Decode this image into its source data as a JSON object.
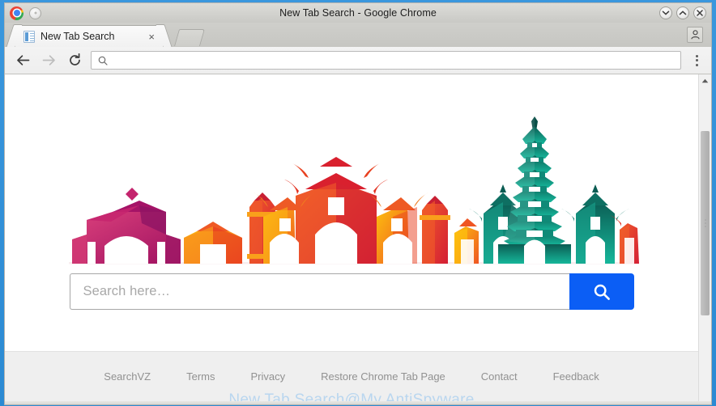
{
  "window": {
    "title": "New Tab Search - Google Chrome",
    "chrome_logo_icon": "chrome-logo-icon",
    "system_menu_icon": "window-menu-icon",
    "controls": [
      {
        "name": "minimize",
        "icon": "chevron-down-icon"
      },
      {
        "name": "maximize",
        "icon": "chevron-up-icon"
      },
      {
        "name": "close",
        "icon": "close-x-icon"
      }
    ]
  },
  "tabstrip": {
    "tab": {
      "title": "New Tab Search",
      "favicon_icon": "page-favicon-icon",
      "close_label": "×"
    },
    "new_tab_icon": "new-tab-icon",
    "profile_icon": "user-profile-icon"
  },
  "toolbar": {
    "back_icon": "arrow-left-icon",
    "forward_icon": "arrow-right-icon",
    "reload_icon": "reload-icon",
    "omnibox": {
      "icon": "search-icon",
      "value": "",
      "placeholder": ""
    },
    "menu_icon": "three-dots-menu-icon"
  },
  "page": {
    "hero": {
      "alt": "colorful low-poly vietnamese landmark skyline illustration",
      "colors": {
        "magenta": "#c21b6a",
        "pink": "#e03a6d",
        "red": "#e03127",
        "orange": "#f26522",
        "amber": "#f9a01b",
        "yellow": "#fdc20e",
        "teal": "#00a08a",
        "green_dark": "#0d6b5e",
        "purple": "#7b2d8e",
        "violet": "#a0348c"
      }
    },
    "search": {
      "placeholder": "Search here…",
      "value": "",
      "button_icon": "search-icon",
      "button_color": "#0b5ef5"
    },
    "footer": {
      "links": [
        "SearchVZ",
        "Terms",
        "Privacy",
        "Restore Chrome Tab Page",
        "Contact",
        "Feedback"
      ],
      "background": "#efefef",
      "link_color": "#919191"
    },
    "watermark": {
      "text": "New Tab Search@My AntiSpyware",
      "color": "#b9d6ef"
    }
  },
  "scrollbar": {
    "up_arrow_icon": "caret-up-icon",
    "thumb_name": "scrollbar-thumb"
  }
}
